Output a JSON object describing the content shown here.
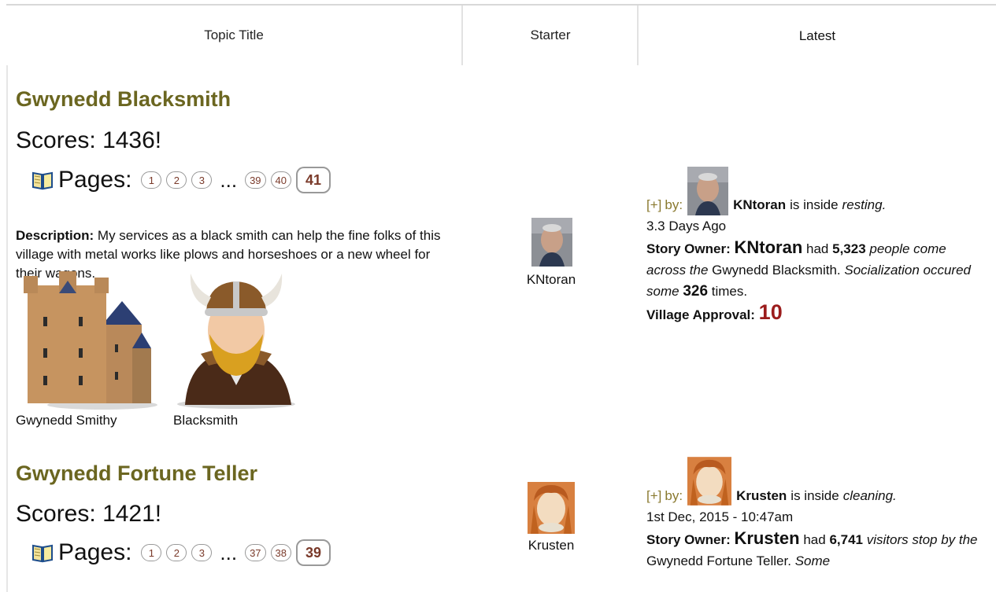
{
  "header": {
    "topic_title": "Topic Title",
    "starter": "Starter",
    "latest": "Latest"
  },
  "topics": [
    {
      "title": "Gwynedd Blacksmith",
      "scores_label": "Scores:",
      "scores_value": "1436!",
      "pages_label": "Pages:",
      "pages": [
        "1",
        "2",
        "3",
        "39",
        "40"
      ],
      "ellipsis": "...",
      "current_page": "41",
      "description_label": "Description:",
      "description": "My services as a black smith can help the fine folks of this village with metal works like plows and horseshoes or a new wheel for their wagons.",
      "images": [
        {
          "caption": "Gwynedd Smithy",
          "icon": "castle-icon"
        },
        {
          "caption": "Blacksmith",
          "icon": "viking-avatar-icon"
        }
      ],
      "starter_name": "KNtoran",
      "latest": {
        "plus": "[+]",
        "by": "by:",
        "user": "KNtoran",
        "status_prefix": "is inside",
        "status": "resting.",
        "time": "3.3 Days Ago",
        "owner_label": "Story Owner:",
        "owner": "KNtoran",
        "had": "had",
        "count": "5,323",
        "count_text": "people come across the",
        "place": "Gwynedd Blacksmith.",
        "social_text": "Socialization occured some",
        "social_count": "326",
        "times": "times.",
        "approval_label": "Village Approval:",
        "approval_value": "10"
      }
    },
    {
      "title": "Gwynedd Fortune Teller",
      "scores_label": "Scores:",
      "scores_value": "1421!",
      "pages_label": "Pages:",
      "pages": [
        "1",
        "2",
        "3",
        "37",
        "38"
      ],
      "ellipsis": "...",
      "current_page": "39",
      "starter_name": "Krusten",
      "latest": {
        "plus": "[+]",
        "by": "by:",
        "user": "Krusten",
        "status_prefix": "is inside",
        "status": "cleaning.",
        "time": "1st Dec, 2015 - 10:47am",
        "owner_label": "Story Owner:",
        "owner": "Krusten",
        "had": "had",
        "count": "6,741",
        "count_text": "visitors stop by the",
        "place": "Gwynedd Fortune Teller.",
        "tail": "Some"
      }
    }
  ]
}
